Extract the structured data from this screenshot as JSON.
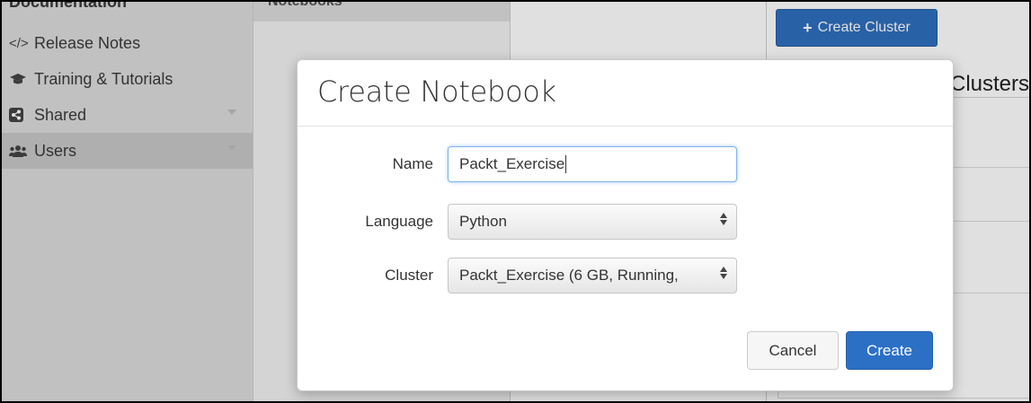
{
  "sidebar": {
    "partial_top_label": "Documentation",
    "items": [
      {
        "label": "Release Notes",
        "icon": "code-icon"
      },
      {
        "label": "Training & Tutorials",
        "icon": "graduation-cap-icon"
      },
      {
        "label": "Shared",
        "icon": "share-icon"
      },
      {
        "label": "Users",
        "icon": "users-icon"
      }
    ]
  },
  "workspace": {
    "column_header": "Notebooks"
  },
  "clusters": {
    "create_button_label": "Create Cluster",
    "title": "Clusters"
  },
  "modal": {
    "title": "Create Notebook",
    "name_label": "Name",
    "name_value": "Packt_Exercise",
    "language_label": "Language",
    "language_value": "Python",
    "cluster_label": "Cluster",
    "cluster_value": "Packt_Exercise (6 GB, Running,",
    "cancel_label": "Cancel",
    "create_label": "Create"
  },
  "colors": {
    "primary_button": "#2c70c6",
    "sidebar_bg": "#dcdcdc",
    "focus_border": "#7fb2ea"
  }
}
